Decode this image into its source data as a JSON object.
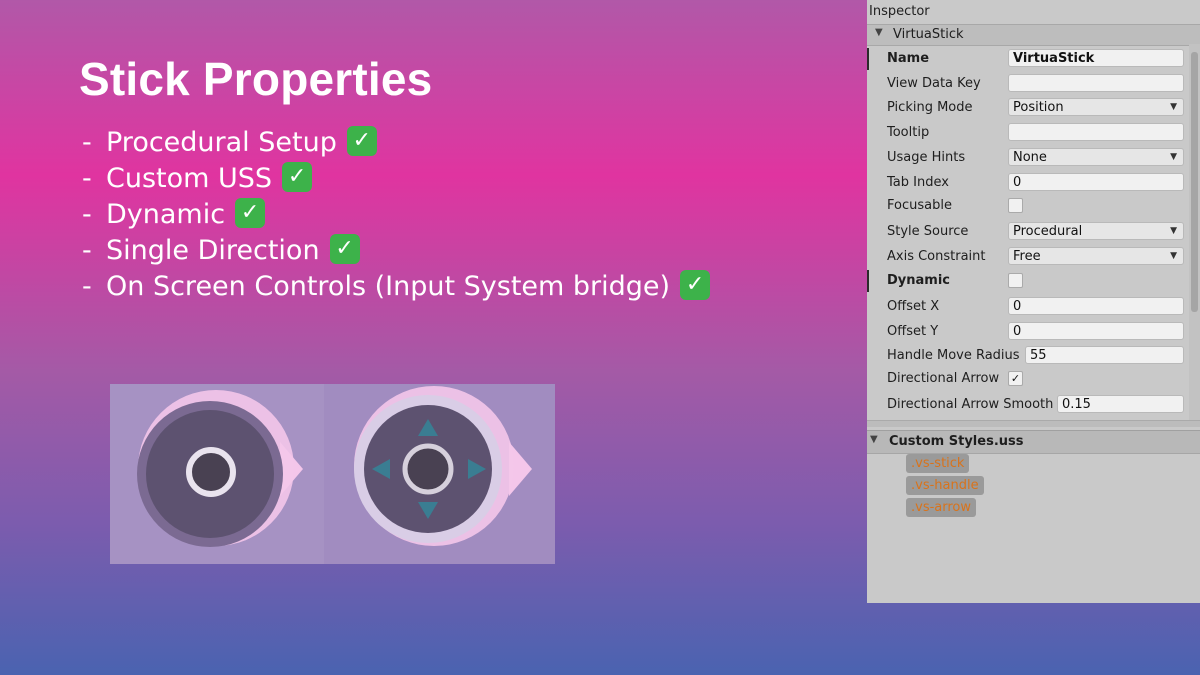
{
  "slide": {
    "title": "Stick Properties",
    "features": [
      {
        "dash": "-",
        "text": "Procedural Setup",
        "check": "✓"
      },
      {
        "dash": "-",
        "text": "Custom USS",
        "check": "✓"
      },
      {
        "dash": "-",
        "text": "Dynamic",
        "check": "✓"
      },
      {
        "dash": "-",
        "text": "Single Direction",
        "check": "✓"
      },
      {
        "dash": "-",
        "text": "On Screen Controls (Input System bridge)",
        "check": "✓"
      }
    ],
    "check_color": "#3db24a"
  },
  "preview": {
    "colors": {
      "ring_outer": "#7b6a92",
      "ring_dark": "#5d5270",
      "handle_ring": "#e9e3ee",
      "handle_fill": "#494152",
      "arrow_pink": "#f4c6ea",
      "arrow_teal": "#3a7d92"
    }
  },
  "inspector": {
    "tab": "Inspector",
    "component": "VirtuaStick",
    "rows": [
      {
        "label": "Name",
        "type": "text",
        "value": "VirtuaStick",
        "bold": true,
        "marker": true
      },
      {
        "label": "View Data Key",
        "type": "text",
        "value": ""
      },
      {
        "label": "Picking Mode",
        "type": "dropdown",
        "value": "Position"
      },
      {
        "label": "Tooltip",
        "type": "text",
        "value": ""
      },
      {
        "label": "Usage Hints",
        "type": "dropdown",
        "value": "None"
      },
      {
        "label": "Tab Index",
        "type": "text",
        "value": "0"
      },
      {
        "label": "Focusable",
        "type": "checkbox",
        "checked": false
      },
      {
        "label": "Style Source",
        "type": "dropdown",
        "value": "Procedural"
      },
      {
        "label": "Axis Constraint",
        "type": "dropdown",
        "value": "Free"
      },
      {
        "label": "Dynamic",
        "type": "checkbox",
        "checked": false,
        "bold": true,
        "marker": true
      },
      {
        "label": "Offset X",
        "type": "text",
        "value": "0"
      },
      {
        "label": "Offset Y",
        "type": "text",
        "value": "0"
      },
      {
        "label": "Handle Move Radius",
        "type": "text",
        "value": "55"
      },
      {
        "label": "Directional Arrow",
        "type": "checkbox",
        "checked": true
      },
      {
        "label": "Directional Arrow Smooth",
        "type": "text",
        "value": "0.15"
      }
    ],
    "uss": {
      "title": "Custom Styles.uss",
      "classes": [
        ".vs-stick",
        ".vs-handle",
        ".vs-arrow"
      ],
      "class_color": "#d9731b"
    }
  }
}
